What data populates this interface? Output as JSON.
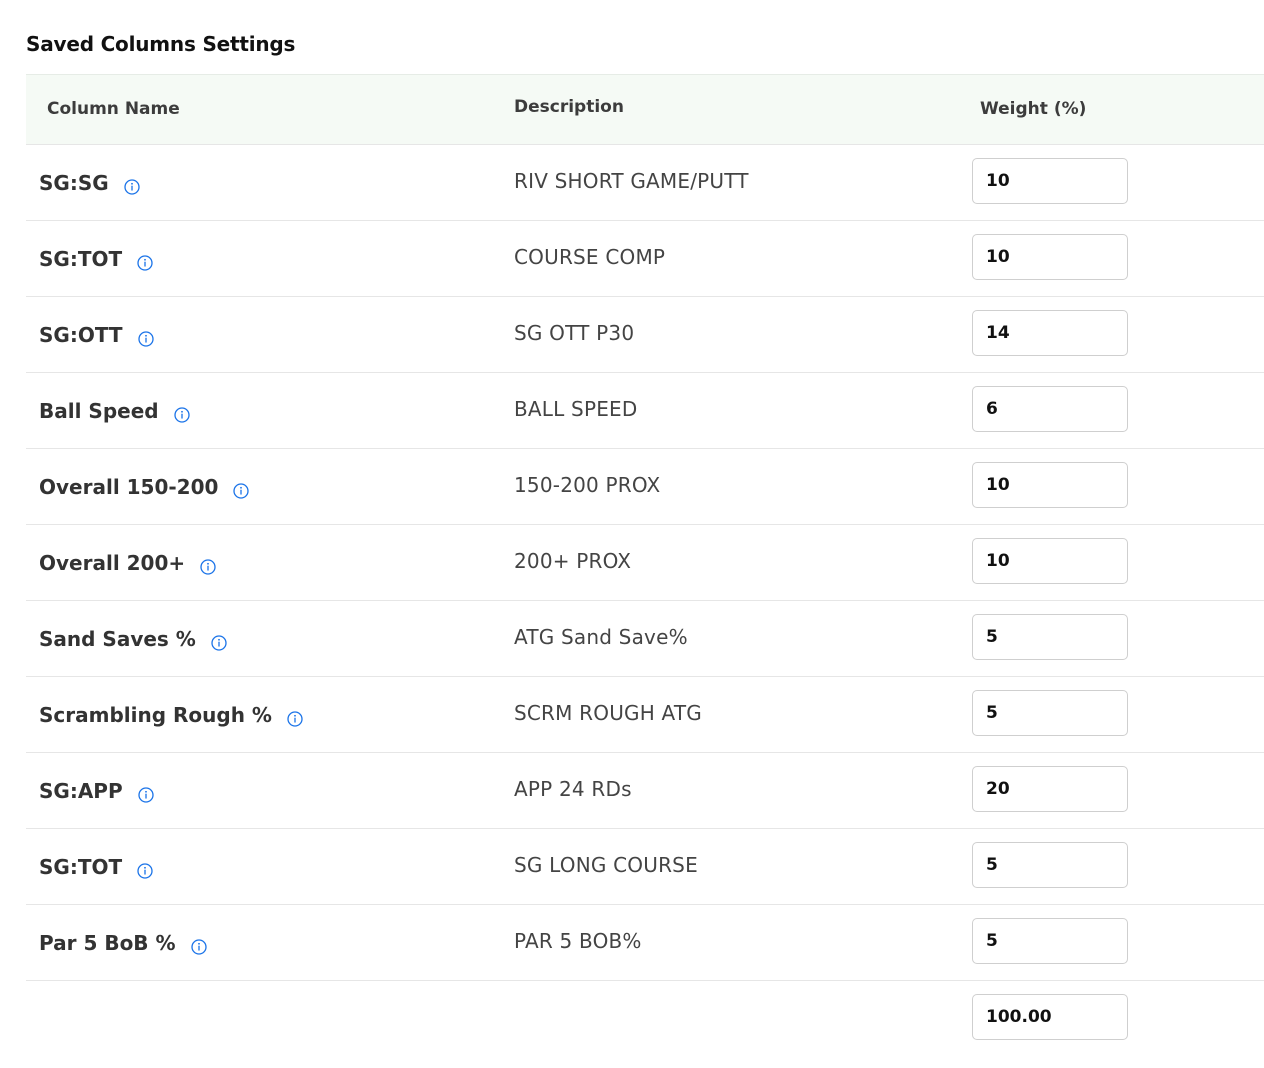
{
  "title": "Saved Columns Settings",
  "headers": {
    "column_name": "Column Name",
    "description": "Description",
    "weight": "Weight (%)"
  },
  "rows": [
    {
      "name": "SG:SG",
      "description": "RIV SHORT GAME/PUTT",
      "weight": "10"
    },
    {
      "name": "SG:TOT",
      "description": "COURSE COMP",
      "weight": "10"
    },
    {
      "name": "SG:OTT",
      "description": "SG OTT P30",
      "weight": "14"
    },
    {
      "name": "Ball Speed",
      "description": "BALL SPEED",
      "weight": "6"
    },
    {
      "name": "Overall 150-200",
      "description": "150-200 PROX",
      "weight": "10"
    },
    {
      "name": "Overall 200+",
      "description": "200+ PROX",
      "weight": "10"
    },
    {
      "name": "Sand Saves %",
      "description": "ATG Sand Save%",
      "weight": "5"
    },
    {
      "name": "Scrambling Rough %",
      "description": "SCRM ROUGH ATG",
      "weight": "5"
    },
    {
      "name": "SG:APP",
      "description": "APP 24 RDs",
      "weight": "20"
    },
    {
      "name": "SG:TOT",
      "description": "SG LONG COURSE",
      "weight": "5"
    },
    {
      "name": "Par 5 BoB %",
      "description": "PAR 5 BOB%",
      "weight": "5"
    }
  ],
  "total": "100.00",
  "icons": {
    "info": "info-circle-icon"
  },
  "colors": {
    "header_bg": "#f5faf5",
    "info_icon": "#1a73e8",
    "border": "#e6e6e6"
  }
}
